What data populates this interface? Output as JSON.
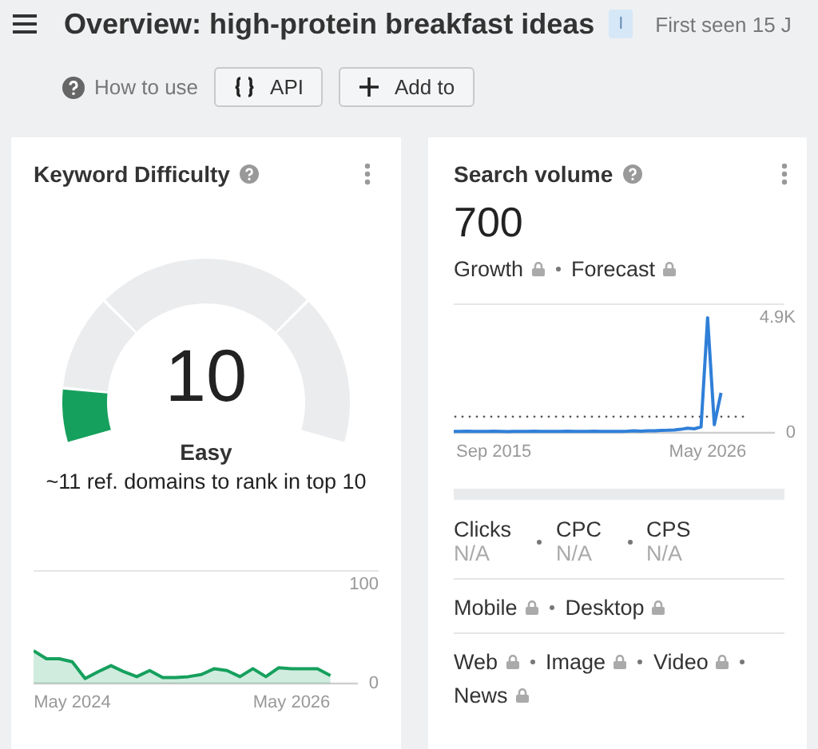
{
  "header": {
    "title": "Overview: high-protein breakfast ideas",
    "intent_badge": "I",
    "first_seen": "First seen 15 J"
  },
  "toolbar": {
    "help_link": "How to use",
    "buttons": [
      {
        "kind": "code",
        "label": "API"
      },
      {
        "kind": "add",
        "label": "Add to"
      }
    ]
  },
  "keyword_difficulty": {
    "title": "Keyword Difficulty",
    "value": "10",
    "rating": "Easy",
    "note": "~11 ref. domains to rank in top 10",
    "chart_data": {
      "type": "area",
      "ylim": [
        0,
        100
      ],
      "yticks": [
        100,
        0
      ],
      "categories": [
        null,
        null,
        null,
        "May 2024",
        null,
        null,
        null,
        null,
        null,
        null,
        null,
        null,
        null,
        null,
        null,
        null,
        null,
        null,
        null,
        null,
        "May 2026",
        null,
        null,
        null
      ],
      "series": [
        {
          "color": "#16a05d",
          "values": [
            33,
            25,
            25,
            22,
            5,
            12,
            18,
            12,
            7,
            13,
            6,
            6,
            7,
            9,
            15,
            13,
            7,
            15,
            7,
            16,
            15,
            15,
            15,
            8
          ]
        }
      ]
    }
  },
  "search_volume": {
    "title": "Search volume",
    "value": "700",
    "tags": [
      {
        "label": "Growth",
        "locked": true
      },
      {
        "label": "Forecast",
        "locked": true
      }
    ],
    "chart_data": {
      "type": "line",
      "ylim": [
        0,
        4900
      ],
      "yticks": [
        {
          "value": 4900,
          "label": "4.9K"
        },
        0
      ],
      "categories": [
        null,
        null,
        null,
        null,
        null,
        null,
        "Sep 2015",
        null,
        null,
        null,
        null,
        null,
        null,
        null,
        null,
        null,
        null,
        null,
        null,
        null,
        null,
        null,
        null,
        null,
        null,
        null,
        null,
        null,
        null,
        null,
        null,
        null,
        null,
        null,
        null,
        null,
        null,
        null,
        "May 2026",
        null,
        null,
        null,
        null,
        null,
        null
      ],
      "series": [
        {
          "color": "#2f7fd8",
          "values": [
            60,
            60,
            70,
            60,
            60,
            60,
            70,
            60,
            50,
            60,
            60,
            60,
            70,
            60,
            60,
            60,
            60,
            70,
            60,
            60,
            60,
            70,
            60,
            60,
            60,
            60,
            70,
            80,
            70,
            80,
            90,
            100,
            110,
            120,
            150,
            200,
            170,
            250,
            4900,
            350,
            1700,
            null,
            null,
            null,
            null
          ]
        }
      ]
    },
    "metrics": [
      {
        "label": "Clicks",
        "value": "N/A"
      },
      {
        "label": "CPC",
        "value": "N/A"
      },
      {
        "label": "CPS",
        "value": "N/A"
      }
    ],
    "devices": [
      {
        "label": "Mobile",
        "locked": true
      },
      {
        "label": "Desktop",
        "locked": true
      }
    ],
    "serp_types": [
      {
        "label": "Web",
        "locked": true
      },
      {
        "label": "Image",
        "locked": true
      },
      {
        "label": "Video",
        "locked": true
      },
      {
        "label": "News",
        "locked": true
      }
    ]
  }
}
